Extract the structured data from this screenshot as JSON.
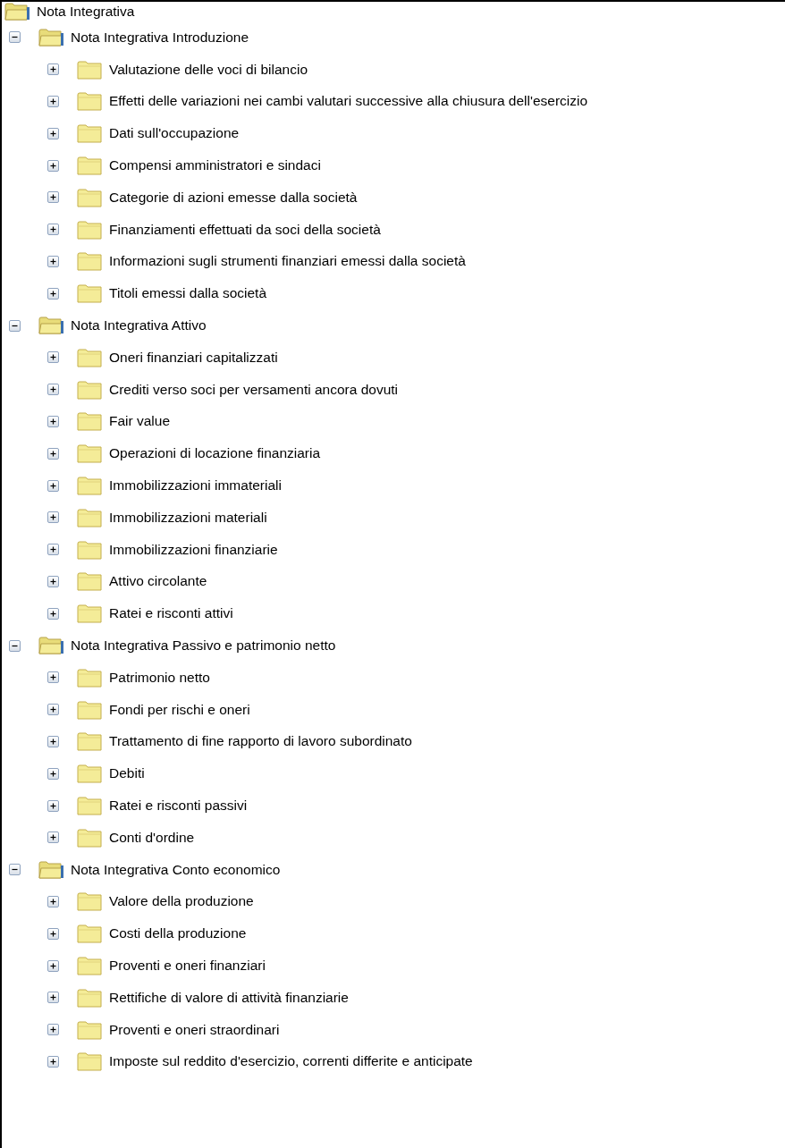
{
  "tree": [
    {
      "label": "Nota Integrativa",
      "expanded": true,
      "children": [
        {
          "label": "Nota Integrativa Introduzione",
          "expanded": true,
          "children": [
            {
              "label": "Valutazione delle voci di bilancio",
              "expanded": false
            },
            {
              "label": "Effetti delle variazioni nei cambi valutari successive alla chiusura dell'esercizio",
              "expanded": false
            },
            {
              "label": "Dati sull'occupazione",
              "expanded": false
            },
            {
              "label": "Compensi amministratori e sindaci",
              "expanded": false
            },
            {
              "label": "Categorie di azioni emesse dalla società",
              "expanded": false
            },
            {
              "label": "Finanziamenti effettuati da soci della società",
              "expanded": false
            },
            {
              "label": "Informazioni sugli strumenti finanziari emessi dalla società",
              "expanded": false
            },
            {
              "label": "Titoli emessi dalla società",
              "expanded": false
            }
          ]
        },
        {
          "label": "Nota Integrativa Attivo",
          "expanded": true,
          "children": [
            {
              "label": "Oneri finanziari capitalizzati",
              "expanded": false
            },
            {
              "label": "Crediti verso soci per versamenti ancora dovuti",
              "expanded": false
            },
            {
              "label": "Fair value",
              "expanded": false
            },
            {
              "label": "Operazioni di locazione finanziaria",
              "expanded": false
            },
            {
              "label": "Immobilizzazioni immateriali",
              "expanded": false
            },
            {
              "label": "Immobilizzazioni materiali",
              "expanded": false
            },
            {
              "label": "Immobilizzazioni finanziarie",
              "expanded": false
            },
            {
              "label": "Attivo circolante",
              "expanded": false
            },
            {
              "label": "Ratei e risconti attivi",
              "expanded": false
            }
          ]
        },
        {
          "label": "Nota Integrativa Passivo e patrimonio netto",
          "expanded": true,
          "children": [
            {
              "label": "Patrimonio netto",
              "expanded": false
            },
            {
              "label": "Fondi per rischi e oneri",
              "expanded": false
            },
            {
              "label": "Trattamento di fine rapporto di lavoro subordinato",
              "expanded": false
            },
            {
              "label": "Debiti",
              "expanded": false
            },
            {
              "label": "Ratei e risconti passivi",
              "expanded": false
            },
            {
              "label": "Conti d'ordine",
              "expanded": false
            }
          ]
        },
        {
          "label": "Nota Integrativa Conto economico",
          "expanded": true,
          "children": [
            {
              "label": "Valore della produzione",
              "expanded": false
            },
            {
              "label": "Costi della produzione",
              "expanded": false
            },
            {
              "label": "Proventi e oneri finanziari",
              "expanded": false
            },
            {
              "label": "Rettifiche di valore di attività finanziarie",
              "expanded": false
            },
            {
              "label": "Proventi e oneri straordinari",
              "expanded": false
            },
            {
              "label": "Imposte sul reddito d'esercizio, correnti differite e anticipate",
              "expanded": false
            }
          ]
        }
      ]
    }
  ]
}
